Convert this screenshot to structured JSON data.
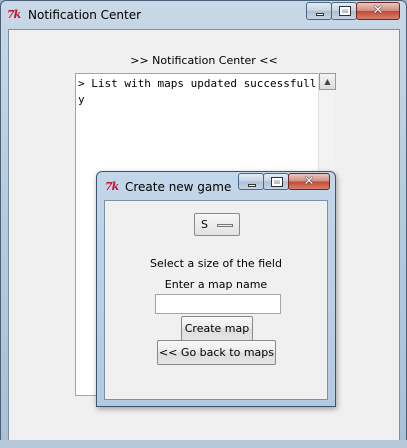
{
  "main_window": {
    "title": "Notification Center",
    "caption": {
      "minimize": "minimize",
      "maximize": "maximize",
      "close": "✕"
    },
    "header_label": ">> Notification Center <<",
    "log_text": "> List with maps updated successfully"
  },
  "dialog": {
    "title": "Create new game",
    "caption": {
      "minimize": "minimize",
      "maximize": "maximize",
      "close": "✕"
    },
    "size_option": "S",
    "size_label": "Select a size of the field",
    "name_label": "Enter a map name",
    "name_value": "",
    "create_button": "Create map",
    "back_button": "<< Go back to maps"
  },
  "icons": {
    "app": "tk-feather-icon",
    "minimize": "minimize-icon",
    "maximize": "maximize-icon",
    "close": "close-icon",
    "scroll_up": "scroll-up-arrow-icon"
  },
  "colors": {
    "titlebar": "#b9cde0",
    "close_button": "#c04a35",
    "client_bg": "#f0f0f0",
    "tk_icon": "#c8102e"
  }
}
